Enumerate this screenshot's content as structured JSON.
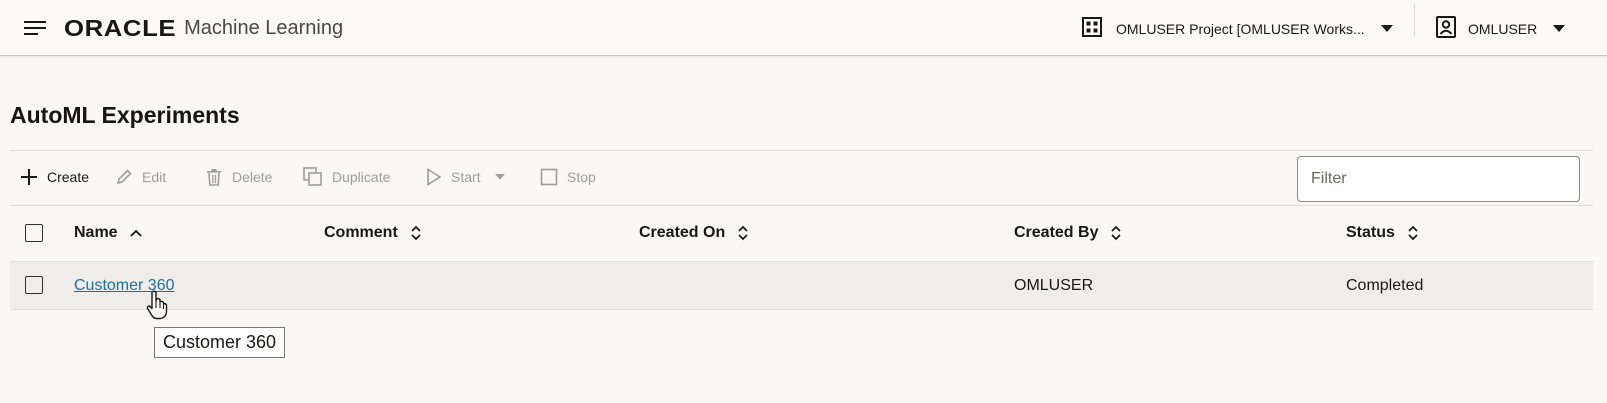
{
  "header": {
    "logo_brand": "ORACLE",
    "logo_product": "Machine Learning",
    "project_selector_label": "OMLUSER Project [OMLUSER Works...",
    "user_label": "OMLUSER"
  },
  "page": {
    "title": "AutoML Experiments"
  },
  "toolbar": {
    "create_label": "Create",
    "edit_label": "Edit",
    "delete_label": "Delete",
    "duplicate_label": "Duplicate",
    "start_label": "Start",
    "stop_label": "Stop",
    "filter_placeholder": "Filter"
  },
  "table": {
    "columns": [
      {
        "label": "Name",
        "sort": "ascending"
      },
      {
        "label": "Comment",
        "sort": "none"
      },
      {
        "label": "Created On",
        "sort": "none"
      },
      {
        "label": "Created By",
        "sort": "none"
      },
      {
        "label": "Status",
        "sort": "none"
      }
    ],
    "rows": [
      {
        "name": "Customer 360",
        "comment": "",
        "created_on": "",
        "created_by": "OMLUSER",
        "status": "Completed"
      }
    ]
  },
  "tooltip": {
    "text": "Customer 360"
  },
  "colors": {
    "link": "#1f6fa0",
    "page_background": "#f9f8f6",
    "row_hover": "#efedea",
    "disabled_text": "#a09d98"
  }
}
